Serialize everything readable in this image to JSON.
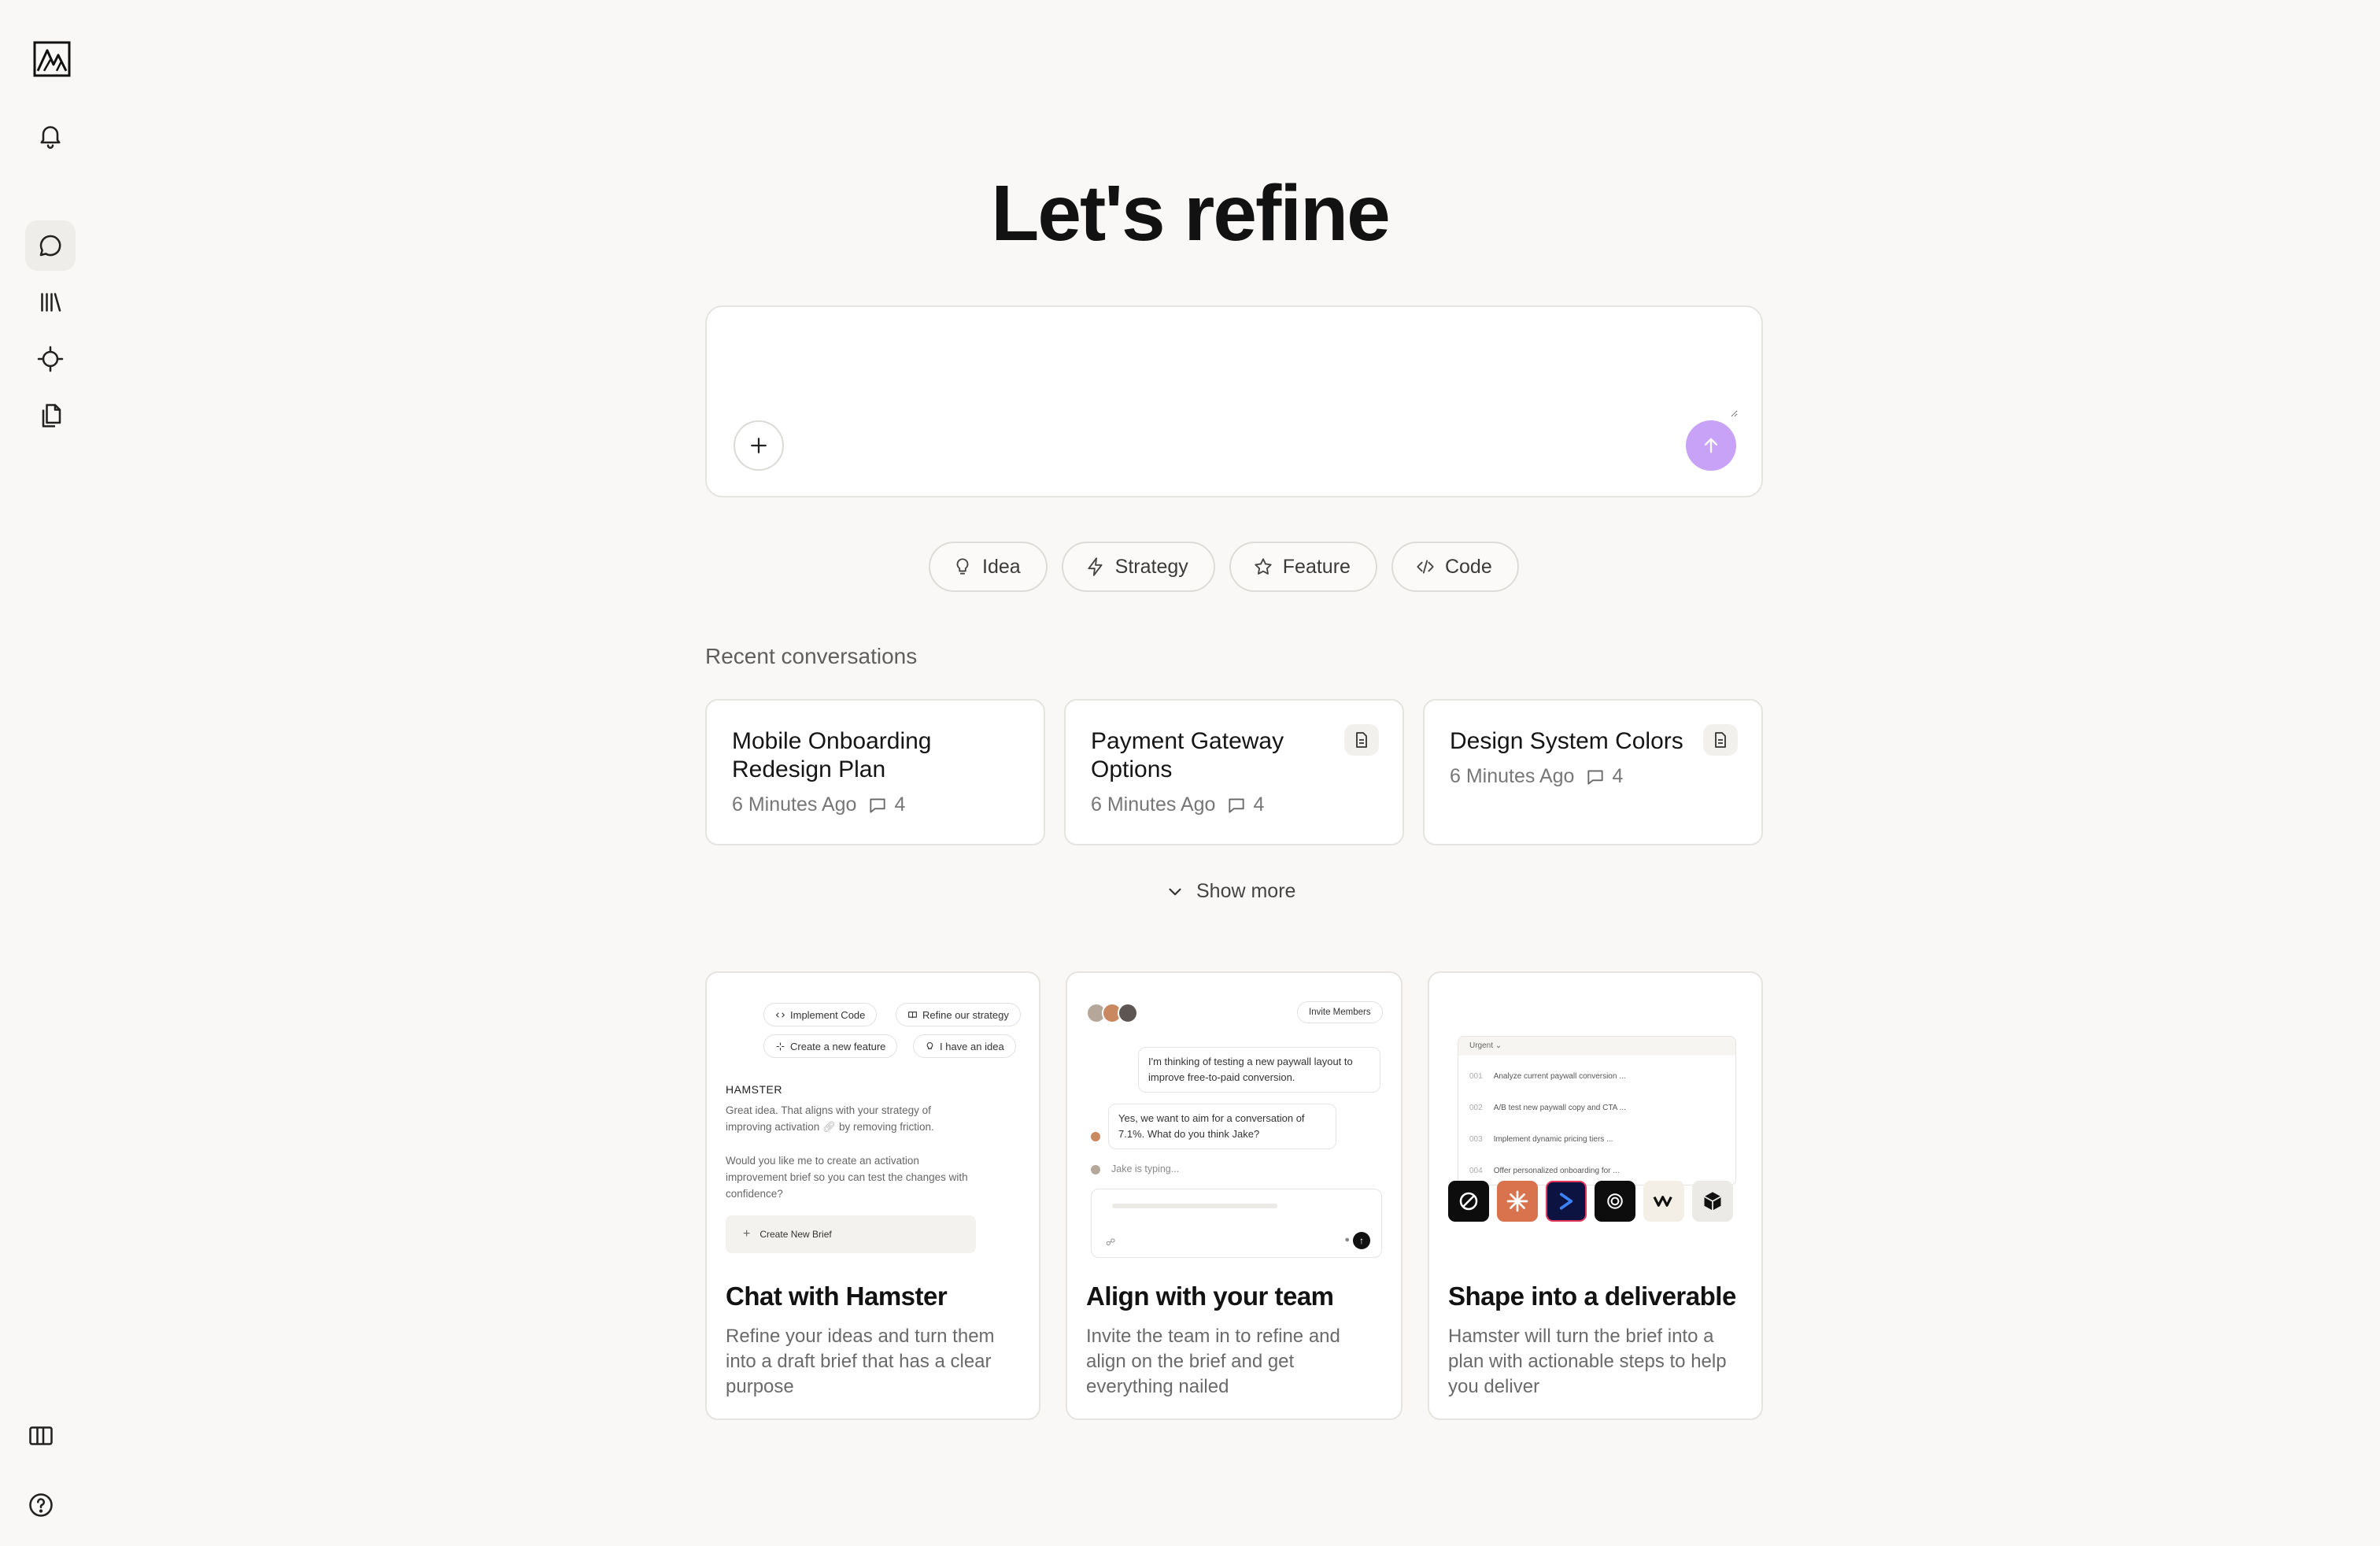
{
  "page": {
    "title": "Let's refine"
  },
  "composer": {
    "placeholder": ""
  },
  "chips": [
    {
      "label": "Idea",
      "icon": "lightbulb-icon"
    },
    {
      "label": "Strategy",
      "icon": "lightning-icon"
    },
    {
      "label": "Feature",
      "icon": "star-icon"
    },
    {
      "label": "Code",
      "icon": "code-icon"
    }
  ],
  "recent": {
    "label": "Recent conversations",
    "items": [
      {
        "title": "Mobile Onboarding Redesign Plan",
        "time": "6 Minutes Ago",
        "count": "4",
        "has_doc": false
      },
      {
        "title": "Payment Gateway Options",
        "time": "6 Minutes Ago",
        "count": "4",
        "has_doc": true
      },
      {
        "title": "Design System Colors",
        "time": "6 Minutes Ago",
        "count": "4",
        "has_doc": true
      }
    ],
    "show_more": "Show more"
  },
  "features": [
    {
      "title": "Chat with Hamster",
      "desc": "Refine your ideas and turn them into a draft brief that has a clear purpose",
      "preview": {
        "chips": [
          "Implement Code",
          "Refine our strategy",
          "Create a new feature",
          "I have an idea"
        ],
        "sender": "HAMSTER",
        "msg1": "Great idea. That aligns with your strategy of improving activation",
        "msg1_tail": "by removing friction.",
        "msg2": "Would you like me to create an activation improvement brief so you can test the changes with confidence?",
        "button": "Create New Brief"
      }
    },
    {
      "title": "Align with your team",
      "desc": "Invite the team in to refine and align on the brief and get everything nailed",
      "preview": {
        "invite": "Invite Members",
        "bubble1": "I'm thinking of testing a new paywall layout to improve free-to-paid conversion.",
        "bubble2": "Yes, we want to aim for a conversation of 7.1%. What do you think Jake?",
        "typing": "Jake is typing..."
      }
    },
    {
      "title": "Shape into a deliverable",
      "desc": "Hamster will turn the brief into a plan with actionable steps to help you deliver",
      "preview": {
        "group": "Urgent",
        "tasks": [
          {
            "id": "001",
            "text": "Analyze current paywall conversion ..."
          },
          {
            "id": "002",
            "text": "A/B test new paywall copy and CTA ..."
          },
          {
            "id": "003",
            "text": "Implement dynamic pricing tiers ..."
          },
          {
            "id": "004",
            "text": "Offer personalized onboarding for ..."
          }
        ]
      }
    }
  ],
  "colors": {
    "accent": "#c8a2f7",
    "background": "#f9f8f6"
  }
}
